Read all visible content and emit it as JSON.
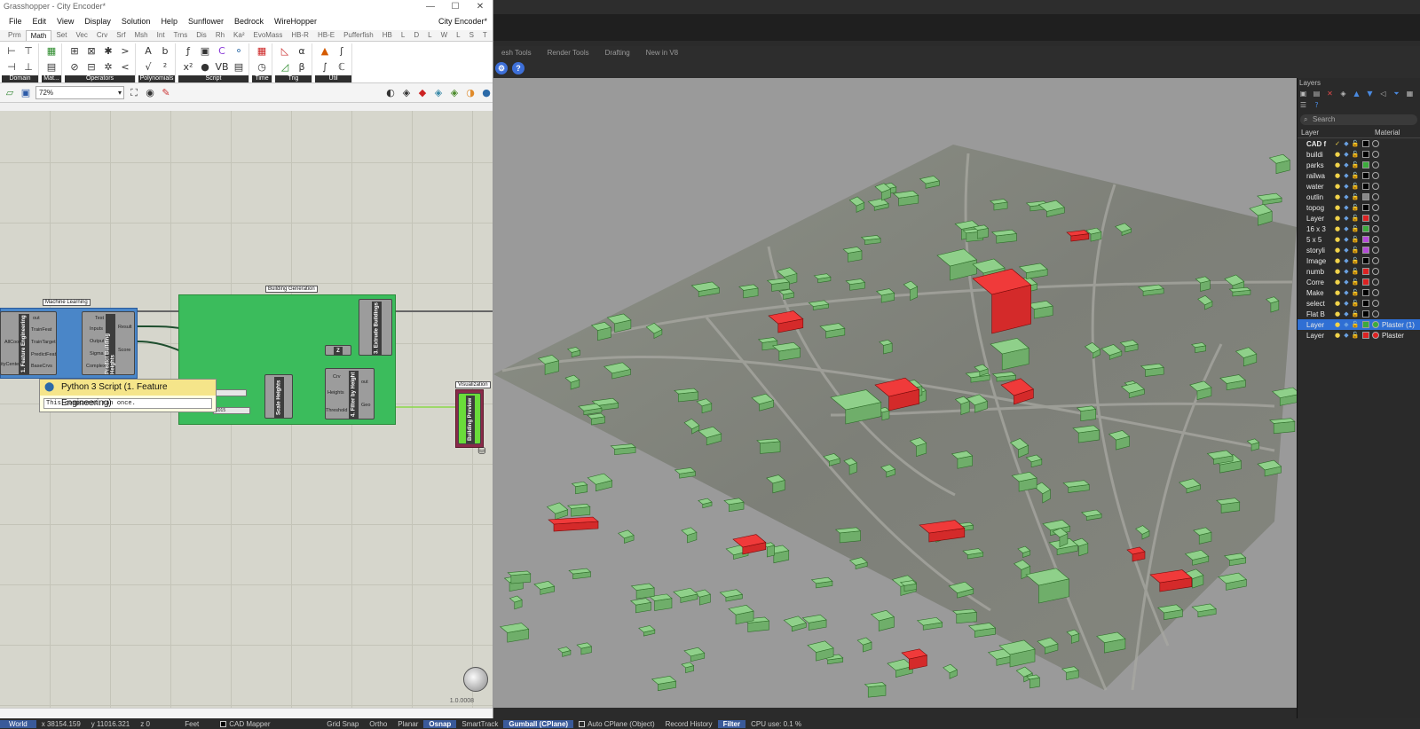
{
  "gh": {
    "title": "Grasshopper - City Encoder*",
    "doc_name": "City Encoder*",
    "menu": [
      "File",
      "Edit",
      "View",
      "Display",
      "Solution",
      "Help",
      "Sunflower",
      "Bedrock",
      "WireHopper"
    ],
    "tabs": [
      "Prm",
      "Math",
      "Set",
      "Vec",
      "Crv",
      "Srf",
      "Msh",
      "Int",
      "Trns",
      "Dis",
      "Rh",
      "Ka²",
      "EvoMass",
      "HB-R",
      "HB-E",
      "Pufferfish",
      "HB",
      "L",
      "D",
      "L",
      "W",
      "L",
      "S",
      "T"
    ],
    "active_tab": "Math",
    "ribbon_groups": [
      "Domain",
      "Mat...",
      "Operators",
      "Polynomials",
      "Script",
      "Time",
      "Trig",
      "Util"
    ],
    "zoom": "72%",
    "version": "1.0.0008",
    "groups": {
      "machine_learning": "Machine Learning",
      "building_generation": "Building Generation",
      "visualization": "Visualization"
    },
    "components": {
      "feature_eng": "1. Feature Engineering",
      "predict": "Predict Building Heights",
      "extrude": "3. Extrude Buildings",
      "scale": "Scale Heights",
      "filter": "4. Filter by Height",
      "preview": "Building Preview",
      "z_label": "Z"
    },
    "ports": {
      "fe_in": [
        "out",
        "TrainFeat",
        "AllCoor",
        "TrainTarget",
        "ityCente",
        "PredictFeat",
        "BaseCrvs"
      ],
      "pr_in": [
        "Test",
        "Inputs",
        "Output",
        "Sigma",
        "Complex"
      ],
      "pr_out": [
        "Result",
        "Score"
      ],
      "filter_in": [
        "Crv",
        "Heights",
        "Threshold"
      ],
      "filter_out": [
        "out",
        "Geo"
      ]
    },
    "slider_value": "1015",
    "tooltip": {
      "title": "Python 3 Script (1. Feature Engineering)",
      "body": "This component ran once."
    }
  },
  "rhino": {
    "tabs": [
      "esh Tools",
      "Render Tools",
      "Drafting",
      "New in V8"
    ],
    "layers_title": "Layers",
    "search_placeholder": "Search",
    "col_layer": "Layer",
    "col_material": "Material",
    "layers": [
      {
        "name": "CAD f",
        "color": "#000000",
        "mat": "",
        "current": true
      },
      {
        "name": "buildi",
        "color": "#000000",
        "mat": ""
      },
      {
        "name": "parks",
        "color": "#3cab3c",
        "mat": ""
      },
      {
        "name": "railwa",
        "color": "#000000",
        "mat": ""
      },
      {
        "name": "water",
        "color": "#000000",
        "mat": ""
      },
      {
        "name": "outlin",
        "color": "#888888",
        "mat": ""
      },
      {
        "name": "topog",
        "color": "#000000",
        "mat": ""
      },
      {
        "name": "Layer",
        "color": "#dd2222",
        "mat": ""
      },
      {
        "name": "16 x 3",
        "color": "#3cab3c",
        "mat": ""
      },
      {
        "name": "5 x 5",
        "color": "#b44ad8",
        "mat": ""
      },
      {
        "name": "storyli",
        "color": "#b44ad8",
        "mat": ""
      },
      {
        "name": "Image",
        "color": "#000000",
        "mat": ""
      },
      {
        "name": "numb",
        "color": "#dd2222",
        "mat": ""
      },
      {
        "name": "Corre",
        "color": "#dd2222",
        "mat": ""
      },
      {
        "name": "Make",
        "color": "#000000",
        "mat": ""
      },
      {
        "name": "select",
        "color": "#000000",
        "mat": ""
      },
      {
        "name": "Flat B",
        "color": "#000000",
        "mat": ""
      },
      {
        "name": "Layer",
        "color": "#3cab3c",
        "mat": "Plaster (1)",
        "selected": true
      },
      {
        "name": "Layer",
        "color": "#dd2222",
        "mat": "Plaster"
      }
    ]
  },
  "status": {
    "cplane": "World",
    "x": "x 38154.159",
    "y": "y 11016.321",
    "z": "z 0",
    "units": "Feet",
    "layer": "CAD Mapper",
    "grid_snap": "Grid Snap",
    "ortho": "Ortho",
    "planar": "Planar",
    "osnap": "Osnap",
    "smarttrack": "SmartTrack",
    "gumball": "Gumball (CPlane)",
    "auto_cplane": "Auto CPlane (Object)",
    "record_history": "Record History",
    "filter": "Filter",
    "cpu": "CPU use: 0.1 %"
  }
}
